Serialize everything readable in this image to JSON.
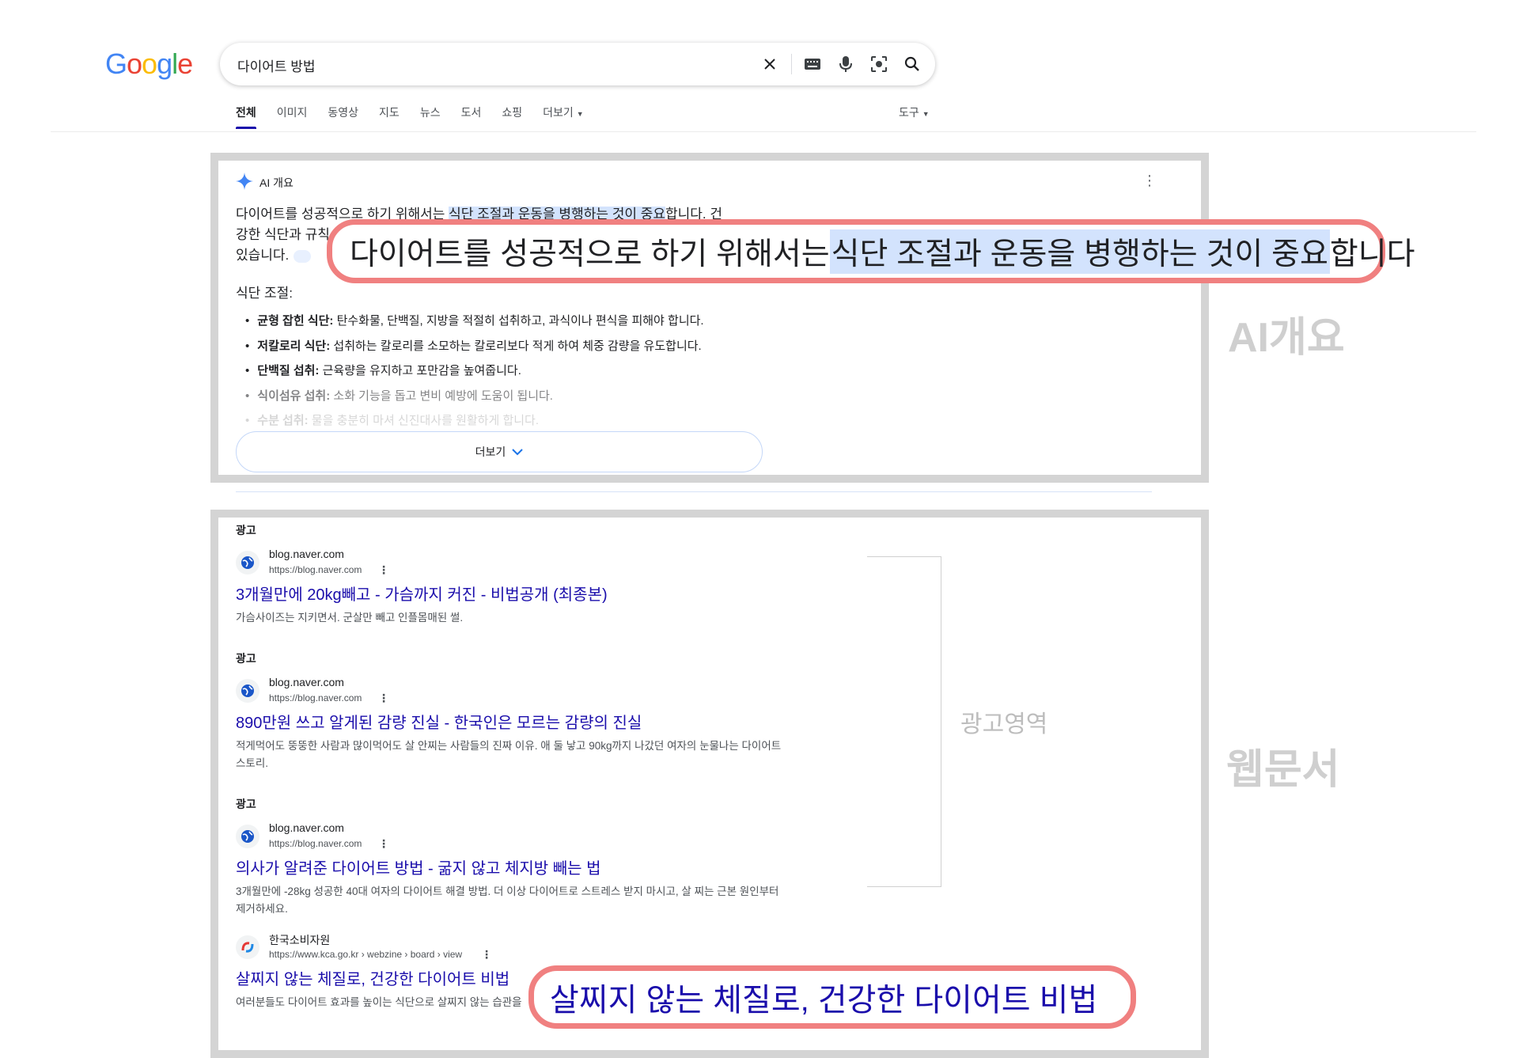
{
  "header": {
    "logo": [
      "G",
      "o",
      "o",
      "g",
      "l",
      "e"
    ],
    "logo_colors": [
      "#4285F4",
      "#EA4335",
      "#FBBC05",
      "#4285F4",
      "#34A853",
      "#EA4335"
    ],
    "query": "다이어트 방법",
    "icons": [
      "close-icon",
      "keyboard-icon",
      "mic-icon",
      "lens-icon",
      "search-icon"
    ]
  },
  "tabs": {
    "items": [
      "전체",
      "이미지",
      "동영상",
      "지도",
      "뉴스",
      "도서",
      "쇼핑",
      "더보기"
    ],
    "tools": "도구"
  },
  "ai_overview": {
    "heading": "AI 개요",
    "para_line1_a": "다이어트를 성공적으로 하기 위해서는 ",
    "para_line1_hl": "식단 조절과 운동을 병행하는 것이 중요",
    "para_line1_b": "합니다. 건",
    "para_line2": "강한 식단과 규칙",
    "para_line3": "있습니다.",
    "subheading": "식단 조절:",
    "items": [
      {
        "bold": "균형 잡힌 식단:",
        "text": " 탄수화물, 단백질, 지방을 적절히 섭취하고, 과식이나 편식을 피해야 합니다."
      },
      {
        "bold": "저칼로리 식단:",
        "text": " 섭취하는 칼로리를 소모하는 칼로리보다 적게 하여 체중 감량을 유도합니다."
      },
      {
        "bold": "단백질 섭취:",
        "text": " 근육량을 유지하고 포만감을 높여줍니다."
      },
      {
        "bold": "식이섬유 섭취:",
        "text": " 소화 기능을 돕고 변비 예방에 도움이 됩니다."
      },
      {
        "bold": "수분 섭취:",
        "text": " 물을 충분히 마셔 신진대사를 원활하게 합니다."
      }
    ],
    "more_label": "더보기"
  },
  "callouts": {
    "ai_a": "다이어트를 성공적으로 하기 위해서는 ",
    "ai_hl": "식단 조절과 운동을 병행하는 것이 중요",
    "ai_b": "합니다",
    "web": "살찌지 않는 체질로, 건강한 다이어트 비법"
  },
  "labels": {
    "ai": "AI개요",
    "web": "웹문서",
    "ad_area": "광고영역"
  },
  "results": [
    {
      "ad": "광고",
      "site": "blog.naver.com",
      "url": "https://blog.naver.com",
      "title": "3개월만에 20kg빼고 - 가슴까지 커진 - 비법공개 (최종본)",
      "desc": "가슴사이즈는 지키면서. 군살만 빼고 인플몸매된 썰."
    },
    {
      "ad": "광고",
      "site": "blog.naver.com",
      "url": "https://blog.naver.com",
      "title": "890만원 쓰고 알게된 감량 진실 - 한국인은 모르는 감량의 진실",
      "desc": "적게먹어도 뚱뚱한 사람과 많이먹어도 살 안찌는 사람들의 진짜 이유. 애 둘 낳고 90kg까지 나갔던 여자의 눈물나는 다이어트 스토리."
    },
    {
      "ad": "광고",
      "site": "blog.naver.com",
      "url": "https://blog.naver.com",
      "title": "의사가 알려준 다이어트 방법 - 굶지 않고 체지방 빼는 법",
      "desc": "3개월만에 -28kg 성공한 40대 여자의 다이어트 해결 방법. 더 이상 다이어트로 스트레스 받지 마시고, 살 찌는 근본 원인부터 제거하세요."
    },
    {
      "site": "한국소비자원",
      "url": "https://www.kca.go.kr › webzine › board › view",
      "title": "살찌지 않는 체질로, 건강한 다이어트 비법",
      "desc": "여러분들도 다이어트 효과를 높이는 식단으로 살찌지 않는 습관을"
    }
  ]
}
